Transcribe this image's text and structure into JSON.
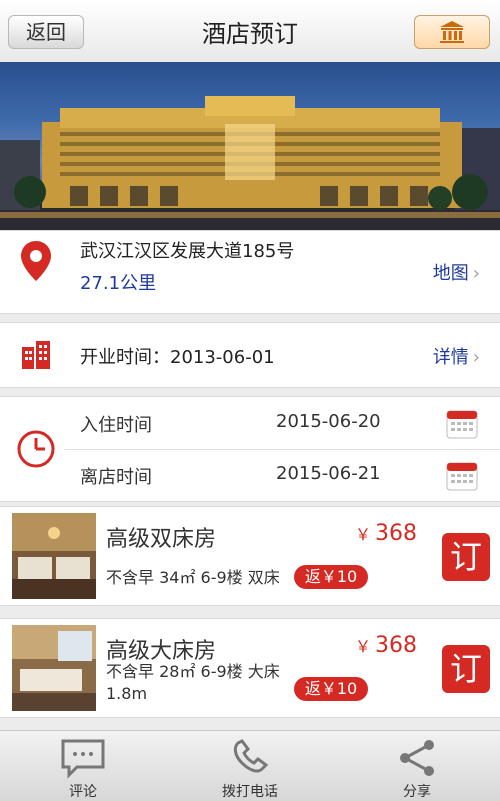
{
  "header": {
    "back_label": "返回",
    "title": "酒店预订",
    "home_icon": "bank-icon"
  },
  "hotel": {
    "address": "武汉江汉区发展大道185号",
    "distance": "27.1公里",
    "map_label": "地图",
    "opening_label": "开业时间：",
    "opening_date": "2013-06-01",
    "detail_label": "详情"
  },
  "stay": {
    "checkin_label": "入住时间",
    "checkin_date": "2015-06-20",
    "checkout_label": "离店时间",
    "checkout_date": "2015-06-21"
  },
  "rooms": [
    {
      "name": "高级双床房",
      "price_symbol": "￥",
      "price": "368",
      "desc": "不含早 34㎡ 6-9楼 双床",
      "cashback": "返￥10",
      "book_label": "订"
    },
    {
      "name": "高级大床房",
      "price_symbol": "￥",
      "price": "368",
      "desc": "不含早 28㎡ 6-9楼 大床1.8m",
      "cashback": "返￥10",
      "book_label": "订"
    }
  ],
  "bottom_tabs": [
    {
      "label": "评论",
      "icon": "comment-icon"
    },
    {
      "label": "拨打电话",
      "icon": "phone-icon"
    },
    {
      "label": "分享",
      "icon": "share-icon"
    }
  ],
  "colors": {
    "accent_red": "#d42a23",
    "link_blue": "#1f3a9e"
  }
}
